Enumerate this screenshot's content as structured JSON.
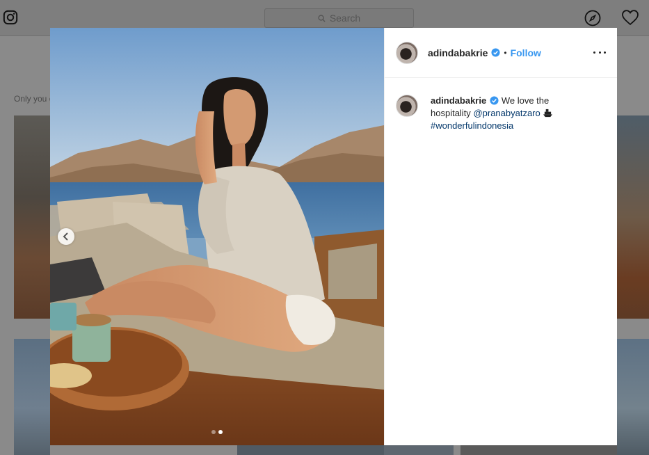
{
  "topbar": {
    "search_placeholder": "Search",
    "icons": {
      "logo": "instagram-logo-icon",
      "search": "search-icon",
      "explore": "compass-icon",
      "activity": "heart-icon"
    }
  },
  "profile_page": {
    "private_note": "Only you c"
  },
  "modal": {
    "photo": {
      "carousel_total": 2,
      "carousel_active": 2,
      "prev_icon": "chevron-left-icon"
    },
    "header": {
      "username": "adindabakrie",
      "separator": "•",
      "follow_label": "Follow",
      "more_icon": "more-options-icon"
    },
    "caption": {
      "username": "adindabakrie",
      "text_before": "We love the hospitality",
      "mention": "@pranabyatzaro",
      "hashtag": "#wonderfulindonesia",
      "emoji_icon": "ship-icon"
    },
    "colors": {
      "link": "#003569",
      "follow": "#3897f0",
      "verified": "#3897f0"
    }
  }
}
